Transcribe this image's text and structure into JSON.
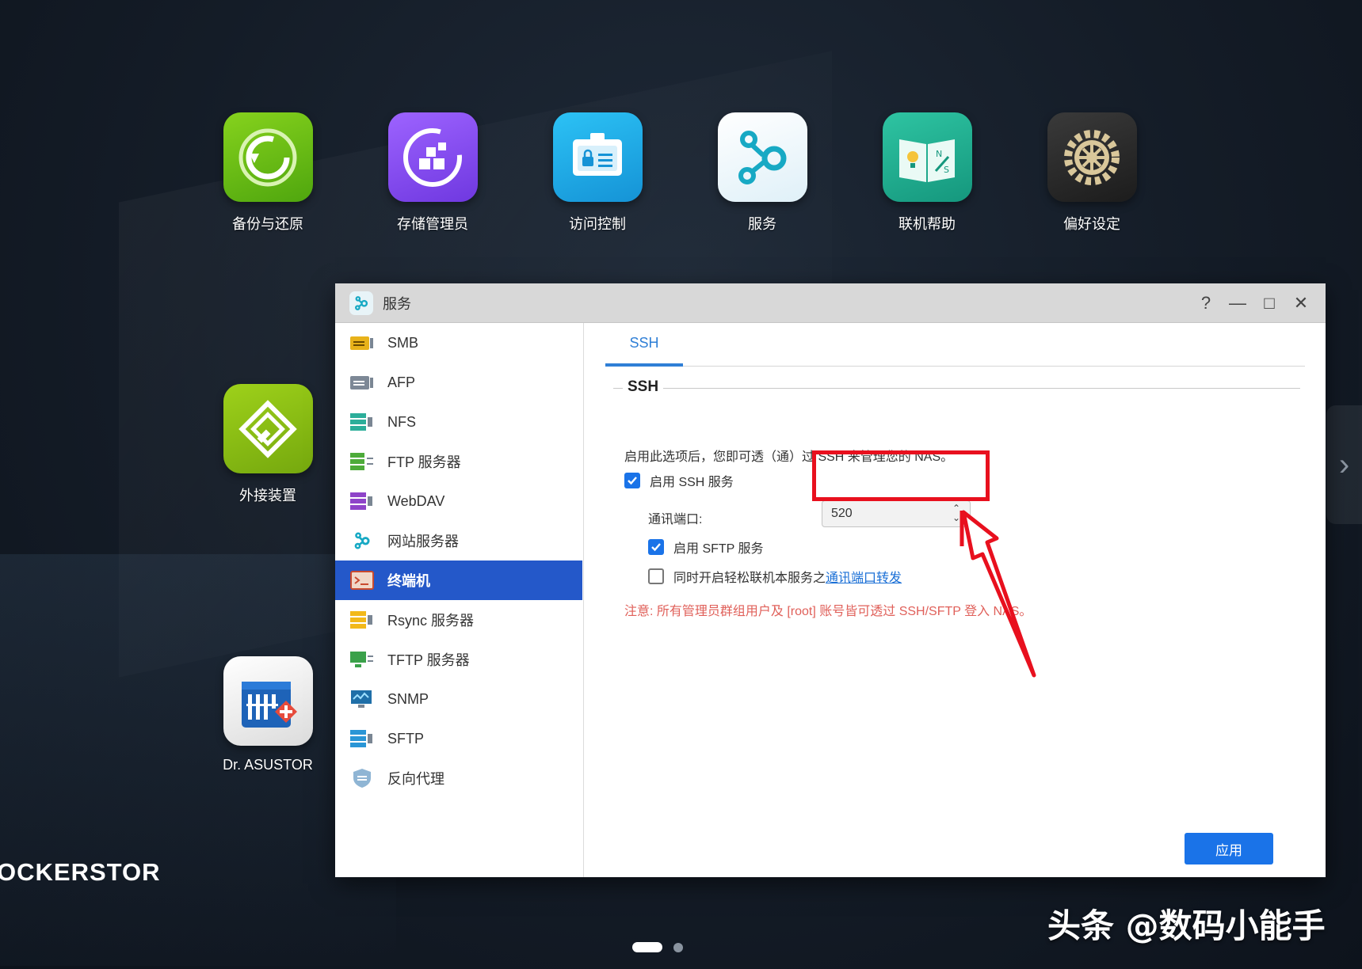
{
  "desktop": {
    "icons": [
      {
        "label": "备份与还原",
        "icon": "backup-restore-icon",
        "color": "#6cbf16"
      },
      {
        "label": "存储管理员",
        "icon": "storage-manager-icon",
        "color": "#8a4df3"
      },
      {
        "label": "访问控制",
        "icon": "access-control-icon",
        "color": "#1fa8e8"
      },
      {
        "label": "服务",
        "icon": "services-icon",
        "color": "#e8f5fa"
      },
      {
        "label": "联机帮助",
        "icon": "online-help-icon",
        "color": "#1aa58a"
      },
      {
        "label": "偏好设定",
        "icon": "preferences-icon",
        "color": "#2c2c2c"
      },
      {
        "label": "外接装置",
        "icon": "external-devices-icon",
        "color": "#8bbf12"
      },
      {
        "label": "Dr. ASUSTOR",
        "icon": "dr-asustor-icon",
        "color": "#f2f2f2"
      }
    ],
    "brand": "OCKERSTOR",
    "watermark": "头条 @数码小能手"
  },
  "window": {
    "title": "服务",
    "controls": {
      "help": "?",
      "minimize": "—",
      "maximize": "□",
      "close": "✕"
    },
    "sidebar": [
      {
        "label": "SMB",
        "icon": "smb-icon"
      },
      {
        "label": "AFP",
        "icon": "afp-icon"
      },
      {
        "label": "NFS",
        "icon": "nfs-icon"
      },
      {
        "label": "FTP 服务器",
        "icon": "ftp-server-icon"
      },
      {
        "label": "WebDAV",
        "icon": "webdav-icon"
      },
      {
        "label": "网站服务器",
        "icon": "web-server-icon"
      },
      {
        "label": "终端机",
        "icon": "terminal-icon",
        "active": true
      },
      {
        "label": "Rsync 服务器",
        "icon": "rsync-server-icon"
      },
      {
        "label": "TFTP 服务器",
        "icon": "tftp-server-icon"
      },
      {
        "label": "SNMP",
        "icon": "snmp-icon"
      },
      {
        "label": "SFTP",
        "icon": "sftp-icon"
      },
      {
        "label": "反向代理",
        "icon": "reverse-proxy-icon"
      }
    ],
    "tab": "SSH",
    "section": {
      "legend": "SSH",
      "description": "启用此选项后，您即可透（通）过 SSH 来管理您的 NAS。",
      "enable_ssh": {
        "label": "启用 SSH 服务",
        "checked": true
      },
      "port_label": "通讯端口:",
      "port_value": "520",
      "enable_sftp": {
        "label": "启用 SFTP 服务",
        "checked": true
      },
      "easy_connect": {
        "label": "同时开启轻松联机本服务之",
        "link": "通讯端口转发",
        "checked": false
      },
      "note": "注意: 所有管理员群组用户及 [root] 账号皆可透过 SSH/SFTP 登入 NAS。"
    },
    "apply_label": "应用"
  },
  "colors": {
    "accent": "#1a73e8",
    "active_item": "#2458c9",
    "annotation": "#e8101e",
    "note": "#e0605a"
  }
}
